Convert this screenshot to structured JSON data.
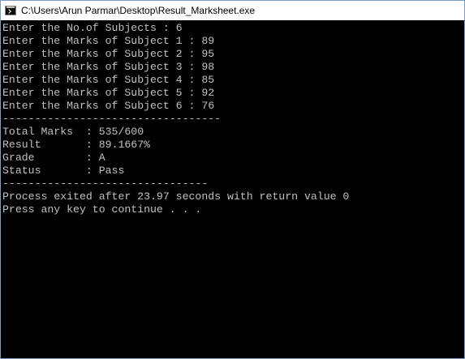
{
  "window": {
    "title": "C:\\Users\\Arun Parmar\\Desktop\\Result_Marksheet.exe",
    "icon": "console-app-icon"
  },
  "console": {
    "lines": [
      "Enter the No.of Subjects : 6",
      "Enter the Marks of Subject 1 : 89",
      "Enter the Marks of Subject 2 : 95",
      "Enter the Marks of Subject 3 : 98",
      "Enter the Marks of Subject 4 : 85",
      "Enter the Marks of Subject 5 : 92",
      "Enter the Marks of Subject 6 : 76",
      "----------------------------------",
      "Total Marks  : 535/600",
      "Result       : 89.1667%",
      "Grade        : A",
      "Status       : Pass",
      "--------------------------------",
      "Process exited after 23.97 seconds with return value 0",
      "Press any key to continue . . ."
    ]
  },
  "colors": {
    "console_background": "#000000",
    "console_text": "#c0c0c0",
    "titlebar_background": "#ffffff",
    "window_border": "#7a9bc5"
  }
}
